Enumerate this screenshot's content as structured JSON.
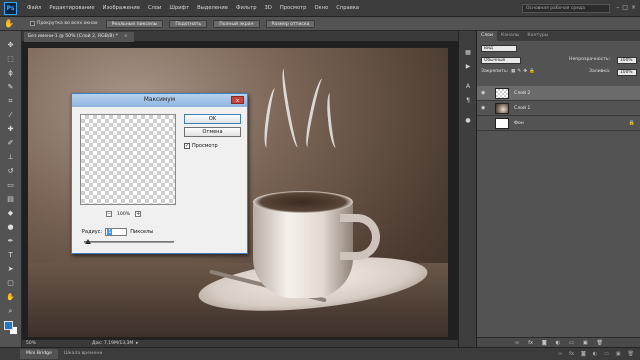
{
  "app": {
    "logo": "Ps"
  },
  "menu": [
    "Файл",
    "Редактирование",
    "Изображение",
    "Слои",
    "Шрифт",
    "Выделение",
    "Фильтр",
    "3D",
    "Просмотр",
    "Окно",
    "Справка"
  ],
  "workspace": {
    "label": "Основная рабочая среда"
  },
  "options": {
    "scroll_all_label": "Прокрутка во всех окнах",
    "buttons": [
      "Реальные пикселы",
      "Подогнать",
      "Полный экран",
      "Размер оттиска"
    ]
  },
  "document": {
    "tab_label": "Без имени-1 @ 50% (Слой 2, RGB/8) *",
    "close": "×"
  },
  "status": {
    "zoom": "50%",
    "doc_info": "Док: 7,19M/13,3M"
  },
  "bottom_tabs": [
    "Mini Bridge",
    "Шкала времени"
  ],
  "dialog": {
    "title": "Максимум",
    "ok": "OK",
    "cancel": "Отмена",
    "preview_label": "Просмотр",
    "preview_checked": "✓",
    "zoom": "100%",
    "radius_label": "Радиус:",
    "radius_value": "1",
    "radius_unit": "Пикселы",
    "close": "x"
  },
  "panels": {
    "tabs": [
      "Слои",
      "Каналы",
      "Контуры"
    ],
    "kind_filter": "Вид",
    "blend_mode": "Обычные",
    "opacity_label": "Непрозрачность:",
    "opacity_value": "100%",
    "lock_label": "Закрепить:",
    "fill_label": "Заливка:",
    "fill_value": "100%",
    "layers": [
      {
        "name": "Слой 2",
        "visible": true,
        "active": true
      },
      {
        "name": "Слой 1",
        "visible": true,
        "active": false
      },
      {
        "name": "Фон",
        "visible": false,
        "active": false
      }
    ]
  },
  "colors": {
    "accent": "#31a8ff",
    "foreground": "#1e78c8",
    "background": "#ffffff"
  }
}
